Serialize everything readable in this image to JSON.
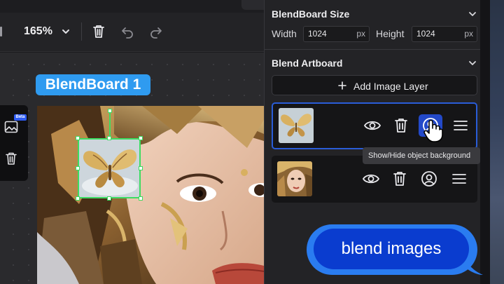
{
  "toolbar": {
    "zoom_label": "165%"
  },
  "canvas": {
    "board_label": "BlendBoard 1",
    "mini_panel": {
      "badge": "Beta"
    }
  },
  "panel": {
    "size_section": {
      "title": "BlendBoard Size",
      "width_label": "Width",
      "width_value": "1024",
      "width_unit": "px",
      "height_label": "Height",
      "height_value": "1024",
      "height_unit": "px"
    },
    "artboard_section": {
      "title": "Blend Artboard",
      "add_button": "Add Image Layer"
    },
    "layers": [
      {
        "name": "butterfly layer",
        "active": true,
        "bg_toggle_active": true
      },
      {
        "name": "portrait layer",
        "active": false,
        "bg_toggle_active": false
      }
    ],
    "tooltip": "Show/Hide object background"
  },
  "caption": {
    "text": "blend images"
  },
  "colors": {
    "accent_blue": "#2a5dd8",
    "selection_green": "#3ddc62",
    "board_tag": "#2f9bf0",
    "caption_bubble": "#0a3ccf"
  }
}
